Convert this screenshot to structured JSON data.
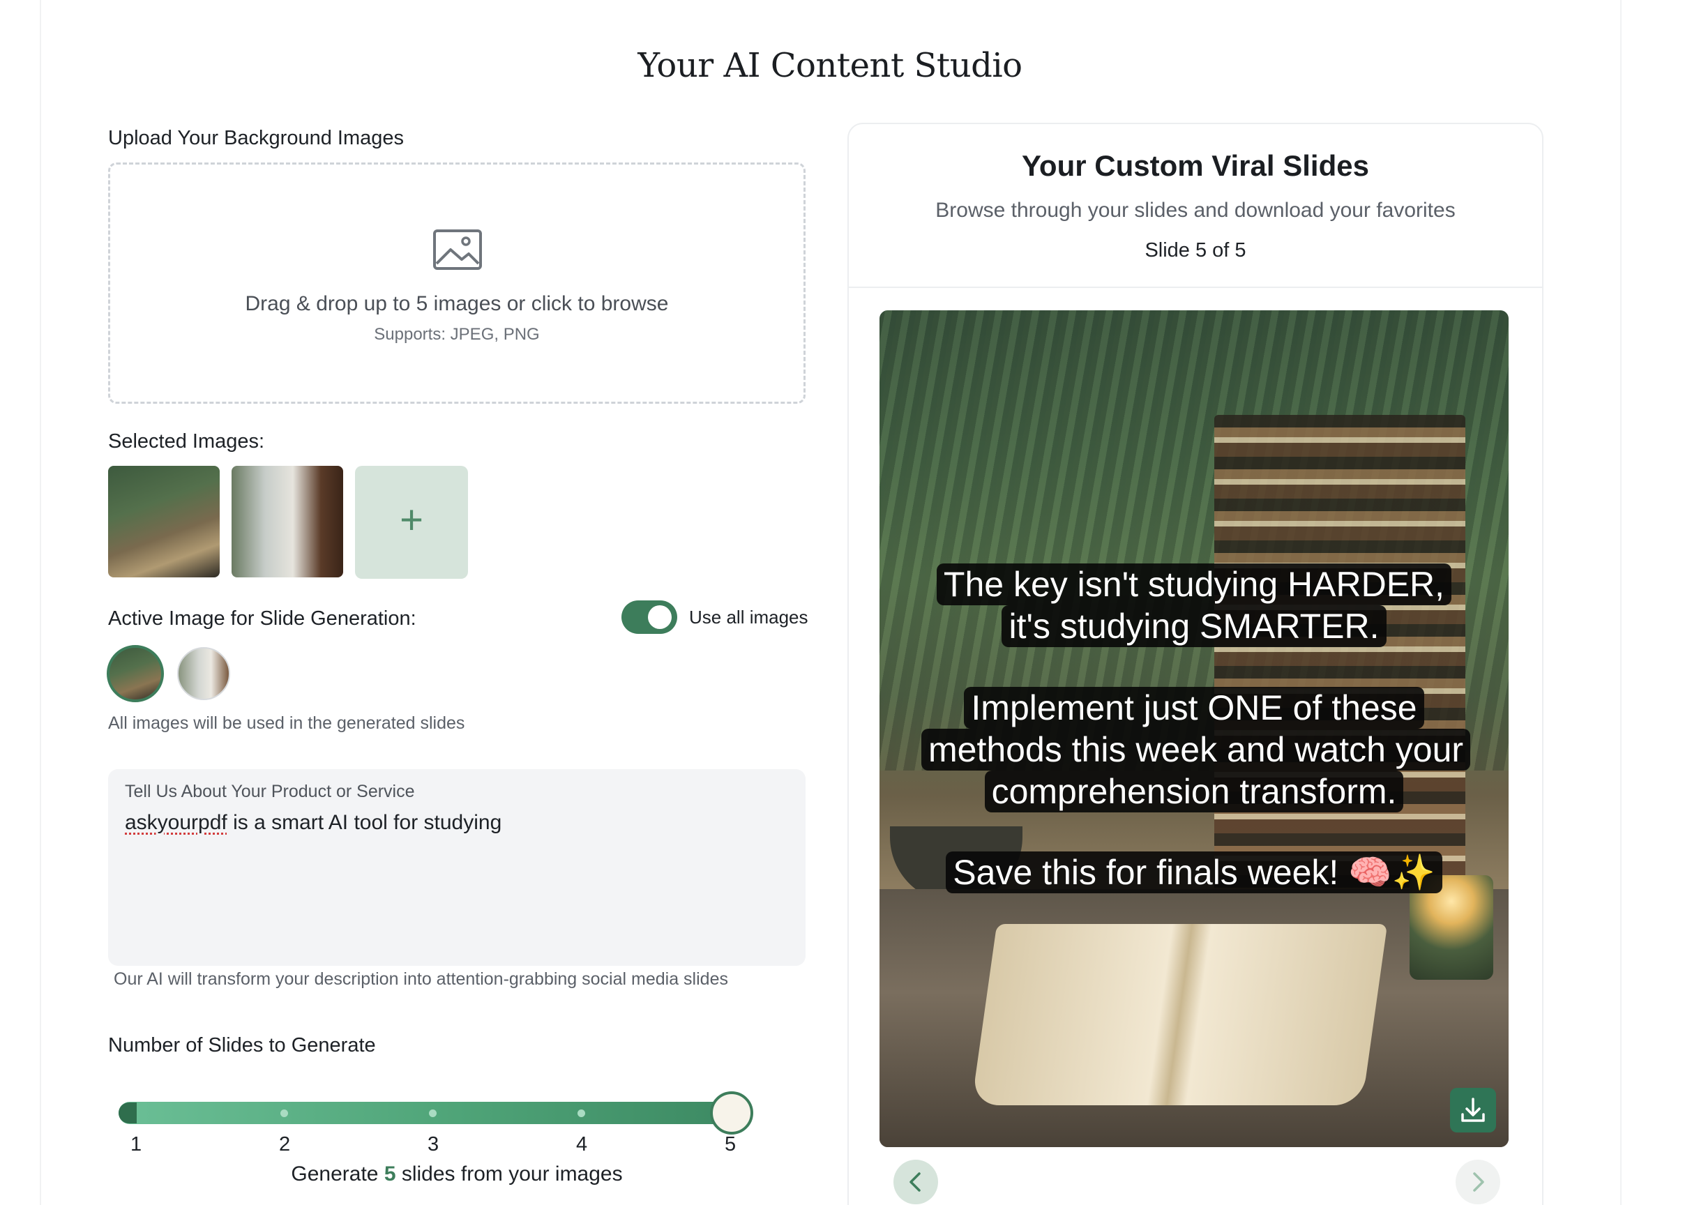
{
  "page": {
    "title": "Your AI Content Studio"
  },
  "upload": {
    "label": "Upload Your Background Images",
    "dropzone_main": "Drag & drop up to 5 images or click to browse",
    "dropzone_sub": "Supports: JPEG, PNG"
  },
  "selected": {
    "label": "Selected Images:",
    "add_symbol": "+"
  },
  "active": {
    "label": "Active Image for Slide Generation:",
    "toggle_label": "Use all images",
    "toggle_on": true,
    "note": "All images will be used in the generated slides"
  },
  "description": {
    "label": "Tell Us About Your Product or Service",
    "value_word1": "askyourpdf",
    "value_rest": " is a smart AI tool for studying",
    "helper": "Our AI will transform your description into attention-grabbing social media slides"
  },
  "slides_count": {
    "label": "Number of Slides to Generate",
    "ticks": [
      "1",
      "2",
      "3",
      "4",
      "5"
    ],
    "value": 5,
    "generate_prefix": "Generate ",
    "generate_num": "5",
    "generate_suffix": " slides from your images"
  },
  "preview": {
    "title": "Your Custom Viral Slides",
    "subtitle": "Browse through your slides and download your favorites",
    "counter": "Slide 5 of 5",
    "caption_1": "The key isn't studying HARDER, it's studying SMARTER.",
    "caption_2": "Implement just ONE of these methods this week and watch your comprehension transform.",
    "caption_3": "Save this for finals week! 🧠✨"
  },
  "colors": {
    "accent": "#3d7d5b",
    "accent_light": "#d6e4db"
  }
}
